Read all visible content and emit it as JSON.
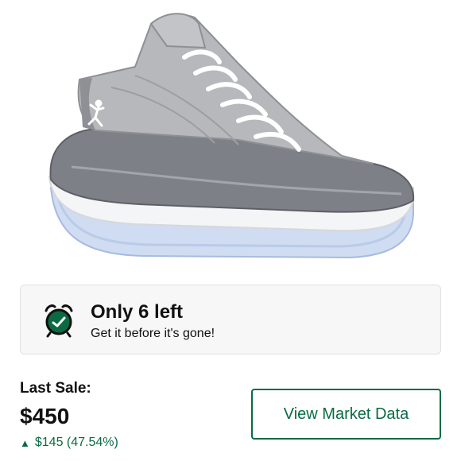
{
  "product": {
    "image_alt": "",
    "image_subject": "gray and white high-top sneaker with icy translucent sole"
  },
  "stock": {
    "icon": "alarm-clock-icon",
    "title": "Only 6 left",
    "subtitle": "Get it before it's gone!"
  },
  "last_sale": {
    "label": "Last Sale:",
    "price": "$450",
    "change_icon": "up-arrow-icon",
    "change": "$145 (47.54%)"
  },
  "actions": {
    "market_data_label": "View Market Data"
  },
  "colors": {
    "accent_green": "#0a6b43",
    "card_background": "#f7f7f7",
    "card_border": "#e1e1e1"
  }
}
